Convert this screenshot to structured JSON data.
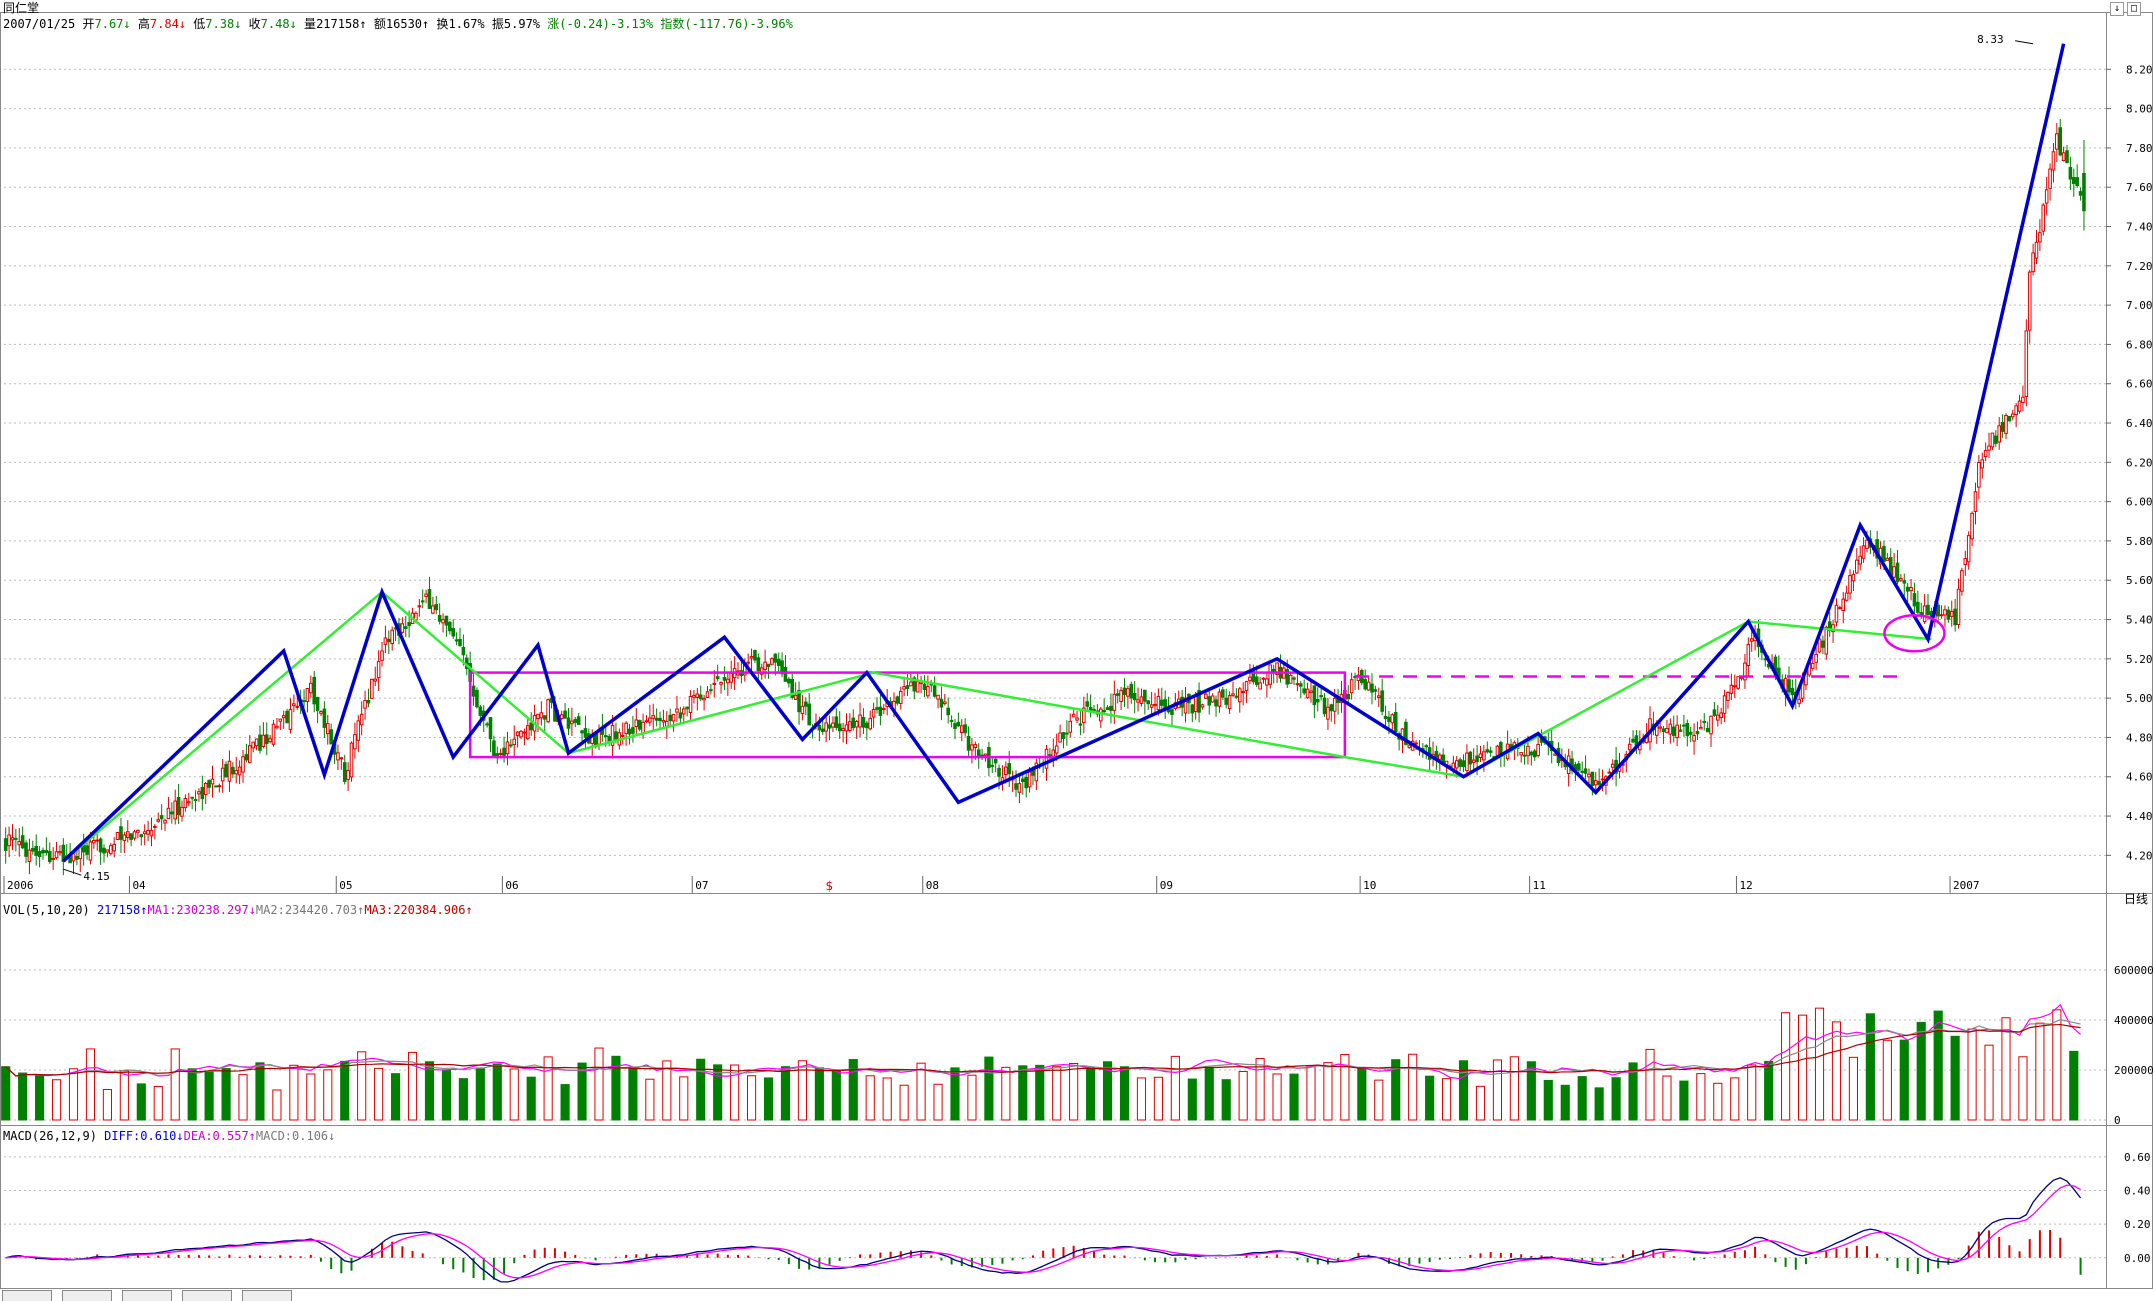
{
  "title": "同仁堂",
  "status_line": {
    "date": "2007/01/25",
    "open_label": "开",
    "open": "7.67",
    "high_label": "高",
    "high": "7.84",
    "low_label": "低",
    "low": "7.38",
    "close_label": "收",
    "close": "7.48",
    "vol_label": "量",
    "vol": "217158",
    "amount_label": "额",
    "amount": "16530",
    "turnover_label": "换",
    "turnover": "1.67%",
    "amplitude_label": "振",
    "amplitude": "5.97%",
    "change_label": "涨",
    "change": "(-0.24)-3.13%",
    "index_label": "指数",
    "index": "(-117.76)-3.96%"
  },
  "period_label": "日线",
  "vol_header": {
    "name": "VOL(5,10,20)",
    "value": "217158",
    "ma1": "MA1:230238.297",
    "ma2": "MA2:234420.703",
    "ma3": "MA3:220384.906"
  },
  "macd_header": {
    "name": "MACD(26,12,9)",
    "diff": "DIFF:0.610",
    "dea": "DEA:0.557",
    "macd": "MACD:0.106"
  },
  "colors": {
    "up": "#e00000",
    "down": "#008000",
    "zigzag_blue": "#0000cc",
    "zigzag_green": "#33ee33",
    "box": "#ee00ee",
    "grid": "#bbbbbb"
  },
  "chart_data": [
    {
      "type": "candlestick",
      "title": "同仁堂 日线",
      "ylim": [
        4.1,
        8.4
      ],
      "yticks": [
        "8.20",
        "8.00",
        "7.80",
        "7.60",
        "7.40",
        "7.20",
        "7.00",
        "6.80",
        "6.60",
        "6.40",
        "6.20",
        "6.00",
        "5.80",
        "5.60",
        "5.40",
        "5.20",
        "5.00",
        "4.80",
        "4.60",
        "4.40",
        "4.20"
      ],
      "x_labels": [
        {
          "i": 0,
          "label": "2006"
        },
        {
          "i": 37,
          "label": "04"
        },
        {
          "i": 98,
          "label": "05"
        },
        {
          "i": 147,
          "label": "06"
        },
        {
          "i": 203,
          "label": "07"
        },
        {
          "i": 271,
          "label": "08"
        },
        {
          "i": 340,
          "label": "09"
        },
        {
          "i": 400,
          "label": "10"
        },
        {
          "i": 450,
          "label": "11"
        },
        {
          "i": 511,
          "label": "12"
        },
        {
          "i": 574,
          "label": "2007"
        }
      ],
      "annotations": [
        {
          "i": 17,
          "price": 4.15,
          "label": "4.15"
        },
        {
          "i": 598,
          "price": 8.33,
          "label": "8.33"
        }
      ],
      "marker": {
        "i": 243,
        "label": "$"
      },
      "keypoints": [
        [
          0,
          4.27
        ],
        [
          18,
          4.18
        ],
        [
          40,
          4.32
        ],
        [
          60,
          4.55
        ],
        [
          80,
          4.85
        ],
        [
          90,
          5.05
        ],
        [
          100,
          4.62
        ],
        [
          112,
          5.3
        ],
        [
          125,
          5.5
        ],
        [
          135,
          5.2
        ],
        [
          145,
          4.7
        ],
        [
          160,
          4.95
        ],
        [
          172,
          4.78
        ],
        [
          185,
          4.85
        ],
        [
          200,
          4.95
        ],
        [
          212,
          5.12
        ],
        [
          225,
          5.2
        ],
        [
          240,
          4.82
        ],
        [
          255,
          4.9
        ],
        [
          270,
          5.1
        ],
        [
          285,
          4.75
        ],
        [
          300,
          4.55
        ],
        [
          315,
          4.88
        ],
        [
          330,
          5.02
        ],
        [
          345,
          4.95
        ],
        [
          360,
          5.0
        ],
        [
          375,
          5.15
        ],
        [
          390,
          4.95
        ],
        [
          400,
          5.1
        ],
        [
          412,
          4.8
        ],
        [
          425,
          4.65
        ],
        [
          440,
          4.72
        ],
        [
          455,
          4.75
        ],
        [
          470,
          4.55
        ],
        [
          485,
          4.85
        ],
        [
          500,
          4.82
        ],
        [
          510,
          5.05
        ],
        [
          515,
          5.3
        ],
        [
          528,
          5.0
        ],
        [
          540,
          5.45
        ],
        [
          550,
          5.8
        ],
        [
          565,
          5.45
        ],
        [
          575,
          5.4
        ],
        [
          582,
          6.2
        ],
        [
          595,
          6.55
        ],
        [
          597,
          7.15
        ],
        [
          605,
          7.85
        ],
        [
          613,
          7.52
        ]
      ],
      "last_bar": {
        "open": 7.67,
        "high": 7.84,
        "low": 7.38,
        "close": 7.48
      },
      "zigzag_blue": [
        [
          17,
          4.17
        ],
        [
          82,
          5.24
        ],
        [
          94,
          4.61
        ],
        [
          111,
          5.54
        ],
        [
          132,
          4.7
        ],
        [
          157,
          5.27
        ],
        [
          166,
          4.72
        ],
        [
          212,
          5.31
        ],
        [
          235,
          4.79
        ],
        [
          254,
          5.13
        ],
        [
          281,
          4.47
        ],
        [
          375,
          5.2
        ],
        [
          430,
          4.6
        ],
        [
          452,
          4.82
        ],
        [
          469,
          4.52
        ],
        [
          514,
          5.39
        ],
        [
          527,
          4.96
        ],
        [
          547,
          5.88
        ],
        [
          567,
          5.3
        ],
        [
          607,
          8.33
        ]
      ],
      "zigzag_green": [
        [
          17,
          4.17
        ],
        [
          111,
          5.54
        ],
        [
          166,
          4.72
        ],
        [
          256,
          5.13
        ],
        [
          395,
          4.7
        ],
        [
          430,
          4.6
        ],
        [
          514,
          5.39
        ],
        [
          568,
          5.3
        ]
      ],
      "box": {
        "i0": 137,
        "i1": 395,
        "p_low": 4.7,
        "p_high": 5.13
      },
      "dashed_level": {
        "i0": 398,
        "i1": 560,
        "price": 5.11
      },
      "circle": {
        "i": 563,
        "price": 5.33
      }
    },
    {
      "type": "bar",
      "title": "VOL(5,10,20)",
      "ylim": [
        0,
        800000
      ],
      "yticks": [
        "600000",
        "400000",
        "200000",
        "0"
      ],
      "series_names": [
        "VOL",
        "MA1",
        "MA2",
        "MA3"
      ]
    },
    {
      "type": "line",
      "title": "MACD(26,12,9)",
      "ylim": [
        -0.12,
        0.7
      ],
      "yticks": [
        "0.60",
        "0.40",
        "0.20",
        "0.00"
      ],
      "series_names": [
        "DIFF",
        "DEA",
        "MACD"
      ]
    }
  ]
}
